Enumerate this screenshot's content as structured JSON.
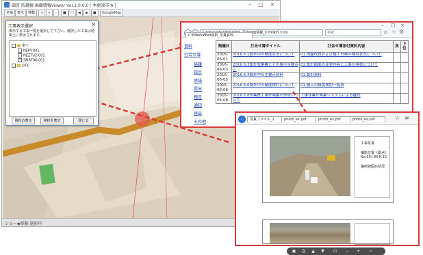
{
  "app": {
    "title": "園芸 防護柵 画面情報Viewer  Ver.1.0.0.0 [ 木更津市 A ]",
    "toolbar": [
      "全画",
      "表示",
      "移動",
      "×",
      "+",
      "-",
      "■",
      "□",
      "◀",
      "▶",
      "■",
      "GoogleMap"
    ],
    "status": "ショー◆移動 選択中"
  },
  "dialog": {
    "title": "工事表示選択",
    "description": "表示する工事一覧を選択して下さい。選択した工事は地図上に表示されます。",
    "tree": [
      {
        "label": "全て",
        "indent": 0
      },
      {
        "label": "NEPY-001",
        "indent": 1
      },
      {
        "label": "NEZTU2-001",
        "indent": 1
      },
      {
        "label": "SMRF06-001",
        "indent": 1
      },
      {
        "label": "DTK",
        "indent": 0
      }
    ],
    "buttons": [
      "資料の表示",
      "資料を表示",
      "閉じる"
    ]
  },
  "browser1": {
    "address": "C:¥Work¥Ex¥資料¥資料_写真画面情報_0.0¥資料.html",
    "search_placeholder": "検索...",
    "tab": "C:¥Work¥Ex¥資料_写真資料...",
    "side_nav": [
      "資料",
      "打合せ簿",
      "協議",
      "指示",
      "承諾",
      "提出",
      "報告",
      "通知",
      "届出",
      "その他"
    ],
    "table": {
      "headers": [
        "発議日",
        "打合せ簿タイトル",
        "打合せ簿添付資料内容",
        "頁",
        "下位"
      ],
      "rows": [
        {
          "date": "2016-06-01",
          "title": "2016.6.1設計中の精度状況について",
          "attach": "01.地盤改良および施工計画の検討状況について"
        },
        {
          "date": "2016-06-03",
          "title": "2016.6.3設計成果書とその後の主要点に",
          "attach": "01.設計図面の変更内容と工事の現状について"
        },
        {
          "date": "2016-06-05",
          "title": "2016.6.4設計中の主要点資料",
          "attach": "01.設計資料"
        },
        {
          "date": "2016-06-06",
          "title": "2016.6.6設計中の精度検討について",
          "attach": "01.施工の精度検討一覧表"
        },
        {
          "date": "2016-06-08",
          "title": "2016.6.8作業員工事計画書の作成について",
          "attach": "工事作業計画書システムによる確認"
        }
      ]
    }
  },
  "browser2": {
    "tabs": [
      "写真ファイル_1",
      "photo_ex.pdf",
      "photo_ex.pdf",
      "photo_ex.pdf"
    ],
    "doc_fields": [
      "工事写真",
      "撮影位置（測点）",
      "No.50+80 R:15",
      "路床締固め状況"
    ],
    "viewer_icons": [
      "save-icon",
      "print-icon",
      "prev-page-icon",
      "next-page-icon",
      "fit-icon",
      "zoom-out-icon",
      "zoom-in-icon",
      "attach-icon"
    ]
  },
  "colors": {
    "accent_red": "#d93838",
    "link_blue": "#1a3fb0",
    "road_orange": "#c98a2a",
    "marker_green": "#4caf50"
  }
}
